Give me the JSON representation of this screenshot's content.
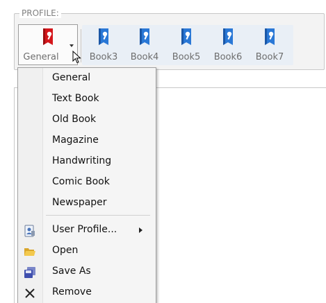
{
  "profile_group": {
    "label": "PROFILE:"
  },
  "toolbar": {
    "general": {
      "label": "General",
      "icon": "red-book-wrench-icon",
      "color": "#d4161b"
    },
    "books": [
      {
        "label": "Book3",
        "icon": "blue-book-wrench-icon",
        "color": "#2a78d6"
      },
      {
        "label": "Book4",
        "icon": "blue-book-wrench-icon",
        "color": "#2a78d6"
      },
      {
        "label": "Book5",
        "icon": "blue-book-wrench-icon",
        "color": "#2a78d6"
      },
      {
        "label": "Book6",
        "icon": "blue-book-wrench-icon",
        "color": "#2a78d6"
      },
      {
        "label": "Book7",
        "icon": "blue-book-wrench-icon",
        "color": "#2a78d6"
      }
    ]
  },
  "menu": {
    "profiles": [
      "General",
      "Text Book",
      "Old Book",
      "Magazine",
      "Handwriting",
      "Comic Book",
      "Newspaper"
    ],
    "actions": [
      {
        "label": "User Profile...",
        "icon": "user-profile-icon",
        "has_submenu": true
      },
      {
        "label": "Open",
        "icon": "folder-open-icon"
      },
      {
        "label": "Save As",
        "icon": "save-as-icon"
      },
      {
        "label": "Remove",
        "icon": "remove-x-icon"
      }
    ]
  }
}
